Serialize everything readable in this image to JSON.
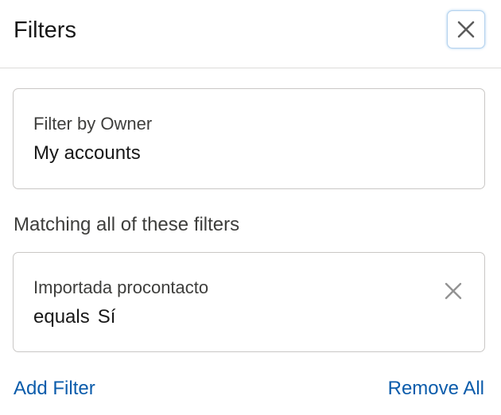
{
  "header": {
    "title": "Filters",
    "close_icon": "close-icon"
  },
  "owner_filter": {
    "label": "Filter by Owner",
    "value": "My accounts"
  },
  "section": {
    "heading": "Matching all of these filters"
  },
  "filters": [
    {
      "field": "Importada procontacto",
      "operator": "equals",
      "value": "Sí",
      "remove_icon": "close-icon"
    }
  ],
  "footer": {
    "add_filter": "Add Filter",
    "remove_all": "Remove All"
  },
  "colors": {
    "link": "#0b5cab",
    "border": "#c9c7c5",
    "text": "#181818",
    "secondary_text": "#3e3e3c",
    "close_focus_ring": "#b5d2ee"
  }
}
